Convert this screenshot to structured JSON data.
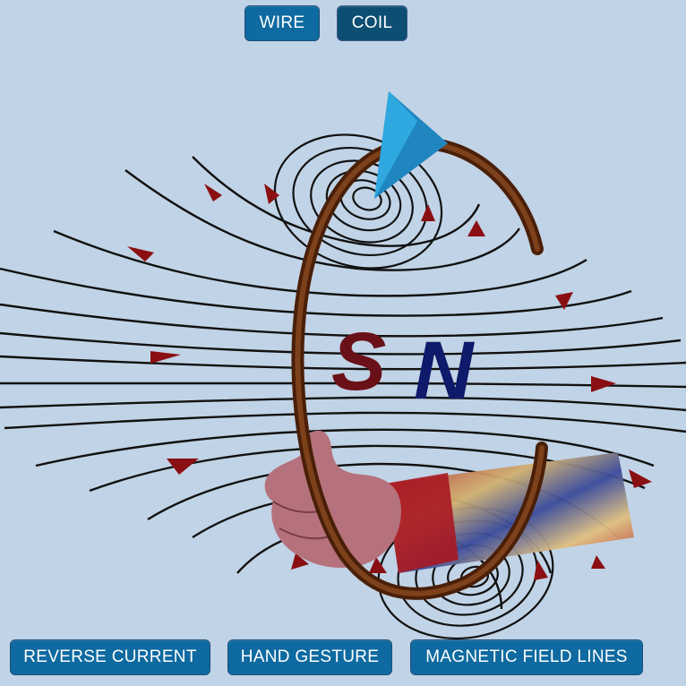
{
  "top_toolbar": {
    "wire_label": "WIRE",
    "coil_label": "COIL",
    "selected": "COIL"
  },
  "bottom_toolbar": {
    "reverse_current_label": "REVERSE CURRENT",
    "hand_gesture_label": "HAND GESTURE",
    "magnetic_field_lines_label": "MAGNETIC FIELD LINES"
  },
  "scene": {
    "south_pole_label": "S",
    "north_pole_label": "N",
    "colors": {
      "background": "#c1d3e6",
      "button": "#0e6aa0",
      "coil": "#6b3214",
      "field_line": "#111111",
      "field_arrow": "#8a0f12",
      "current_arrow": "#1f86c0",
      "south_pole": "#6a1018",
      "north_pole": "#101a6a",
      "hand": "#b5727c",
      "sleeve": "#c8a050"
    }
  }
}
